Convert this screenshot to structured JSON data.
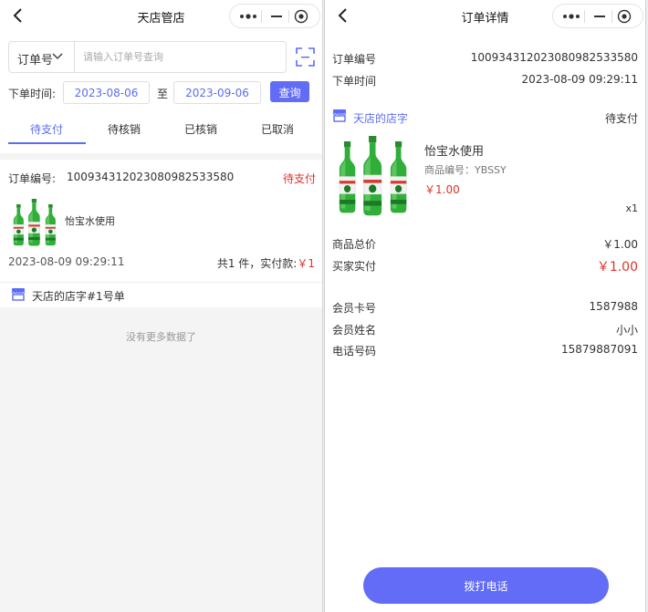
{
  "left": {
    "nav_title": "天店管店",
    "search": {
      "type_label": "订单号",
      "placeholder": "请输入订单号查询",
      "date_label": "下单时间:",
      "start_date": "2023-08-06",
      "separator": "至",
      "end_date": "2023-09-06",
      "query_label": "查询"
    },
    "tabs": [
      "待支付",
      "待核销",
      "已核销",
      "已取消"
    ],
    "order": {
      "no_label": "订单编号:",
      "no": "1009343120230809825335​80",
      "status": "待支付",
      "product_name": "怡宝水使用",
      "time": "2023-08-09 09:29:11",
      "total_text": "共1 件，实付款:",
      "amount": "￥1"
    },
    "store_text": "天店的店字#1号单",
    "no_more": "没有更多数据了"
  },
  "right": {
    "nav_title": "订单详情",
    "order_no_label": "订单编号",
    "order_no": "1009343120230809825335​80",
    "order_time_label": "下单时间",
    "order_time": "2023-08-09 09:29:11",
    "store_name": "天店的店字",
    "status": "待支付",
    "product_name": "怡宝水使用",
    "product_code": "商品编号：YBSSY",
    "product_price": "￥1.00",
    "quantity": "x1",
    "goods_total_label": "商品总价",
    "goods_total": "￥1.00",
    "paid_label": "买家实付",
    "paid": "￥1.00",
    "member_card_label": "会员卡号",
    "member_card": "1587988",
    "member_name_label": "会员姓名",
    "member_name": "小小",
    "phone_label": "电话号码",
    "phone": "15879887091",
    "call_label": "拨打电话"
  },
  "colors": {
    "accent": "#636cf6",
    "price_red": "#e0322a"
  },
  "icons": [
    "back-arrow-icon",
    "more-dots-icon",
    "minimize-icon",
    "close-target-icon",
    "chevron-down-icon",
    "scan-icon",
    "store-icon",
    "beer-bottle-image"
  ]
}
